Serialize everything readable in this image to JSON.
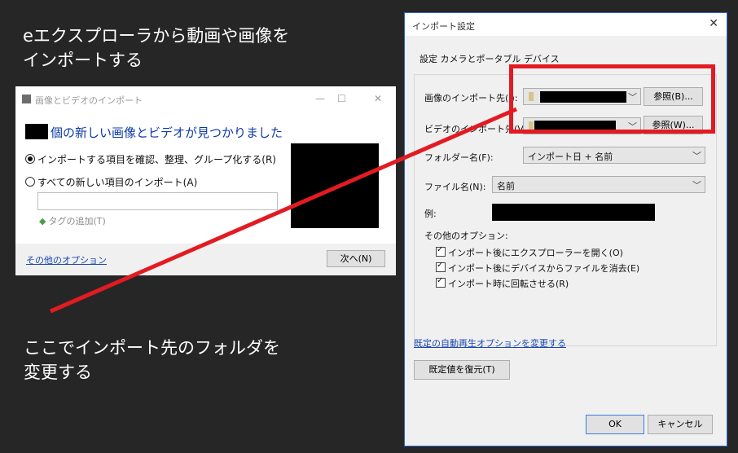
{
  "annotations": {
    "top": "eエクスプローラから動画や画像を\nインポートする",
    "bottom": "ここでインポート先のフォルダを\n変更する"
  },
  "import_window": {
    "title": "画像とビデオのインポート",
    "controls": {
      "minimize": "—",
      "maximize": "☐",
      "close": "✕"
    },
    "headline": "個の新しい画像とビデオが見つかりました",
    "options": [
      {
        "label": "インポートする項目を確認、整理、グループ化する(R)",
        "selected": true
      },
      {
        "label": "すべての新しい項目のインポート(A)",
        "selected": false
      }
    ],
    "tag_input": {
      "value": ""
    },
    "tag_link": "タグの追加(T)",
    "more_options": "その他のオプション",
    "next_button": "次へ(N)"
  },
  "settings_dialog": {
    "title": "インポート設定",
    "close": "✕",
    "group_title": "設定  カメラとポータブル デバイス",
    "image_dest_label": "画像のインポート先(I):",
    "browse_image": "参照(B)...",
    "video_dest_label": "ビデオのインポート先(V):",
    "browse_video": "参照(W)...",
    "folder_name_label": "フォルダー名(F):",
    "folder_name_value": "インポート日 + 名前",
    "file_name_label": "ファイル名(N):",
    "file_name_value": "名前",
    "example_label": "例:",
    "other_options_label": "その他のオプション:",
    "checks": [
      {
        "label": "インポート後にエクスプローラーを開く(O)",
        "checked": true
      },
      {
        "label": "インポート後にデバイスからファイルを消去(E)",
        "checked": true
      },
      {
        "label": "インポート時に回転させる(R)",
        "checked": true
      }
    ],
    "autoplay_link": "既定の自動再生オプションを変更する",
    "restore_button": "既定値を復元(T)",
    "ok_button": "OK",
    "cancel_button": "キャンセル"
  },
  "colors": {
    "highlight": "#e21b23",
    "link": "#1a48b0",
    "dialog_border": "#2b66d6"
  }
}
